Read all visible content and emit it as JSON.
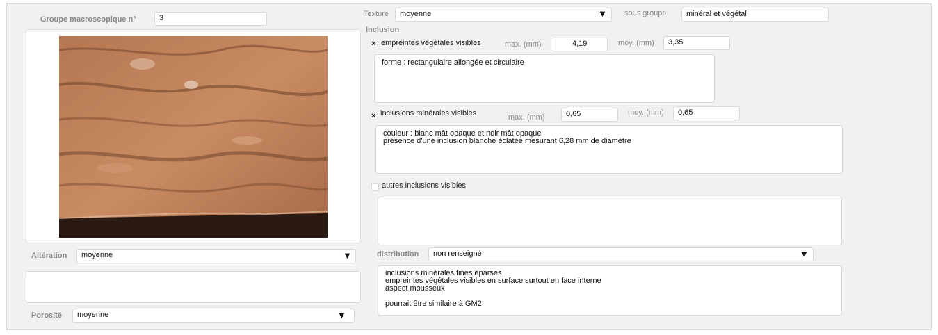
{
  "groupe": {
    "label": "Groupe macroscopique n°",
    "value": "3"
  },
  "photo": {
    "description": "photo-of-sample"
  },
  "alteration": {
    "label": "Altération",
    "value": "moyenne"
  },
  "porosite": {
    "label": "Porosité",
    "value": "moyenne"
  },
  "texture": {
    "label": "Texture",
    "value": "moyenne"
  },
  "sous_groupe": {
    "label": "sous groupe",
    "value": "minéral et végétal"
  },
  "inclusion": {
    "title": "Inclusion",
    "vegetales": {
      "check": "×",
      "label": "empreintes végétales visibles",
      "max_label": "max. (mm)",
      "max_value": "4,19",
      "moy_label": "moy. (mm)",
      "moy_value": "3,35",
      "notes": "forme : rectangulaire allongée et circulaire"
    },
    "minerales": {
      "check": "×",
      "label": "inclusions minérales visibles",
      "max_label": "max. (mm)",
      "max_value": "0,65",
      "moy_label": "moy. (mm)",
      "moy_value": "0,65",
      "notes": "couleur : blanc mât opaque et noir mât opaque\nprésence d'une inclusion blanche éclatée mesurant 6,28 mm de diamètre"
    },
    "autres": {
      "label": "autres inclusions visibles",
      "notes": ""
    }
  },
  "distribution": {
    "label": "distribution",
    "value": "non renseigné",
    "notes": "inclusions minérales fines éparses\nempreintes végétales visibles en surface surtout en face interne\naspect mousseux\n\npourrait être similaire à GM2"
  },
  "dropdown_icon": "triangle-down-icon"
}
